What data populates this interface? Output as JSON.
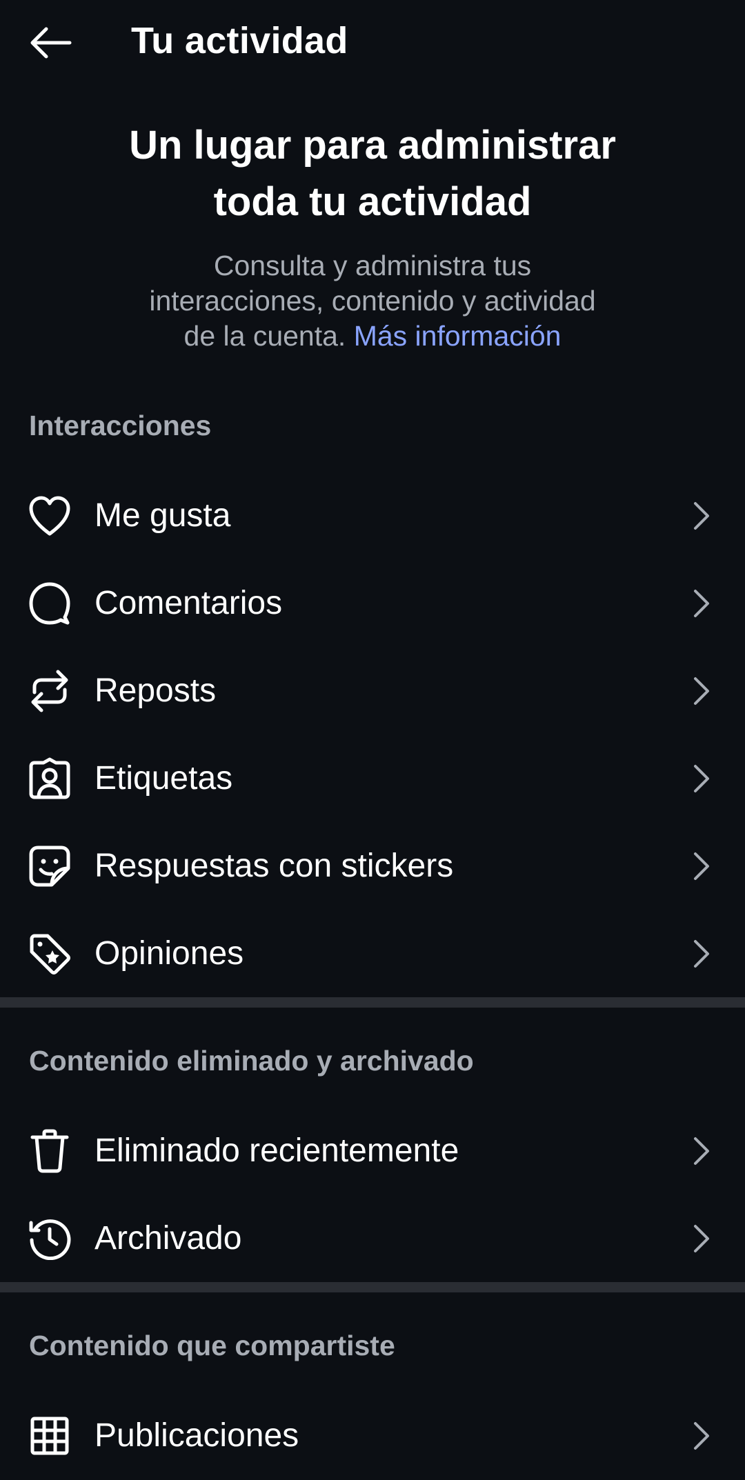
{
  "header": {
    "title": "Tu actividad"
  },
  "hero": {
    "title_line1": "Un lugar para administrar",
    "title_line2": "toda tu actividad",
    "description_line1": "Consulta y administra tus",
    "description_line2": "interacciones, contenido y actividad",
    "description_line3": "de la cuenta. ",
    "link": "Más información",
    "link_color": "#8aa4ff"
  },
  "sections": [
    {
      "header": "Interacciones",
      "items": [
        {
          "label": "Me gusta",
          "icon": "heart-icon"
        },
        {
          "label": "Comentarios",
          "icon": "comment-icon"
        },
        {
          "label": "Reposts",
          "icon": "repost-icon"
        },
        {
          "label": "Etiquetas",
          "icon": "tag-person-icon"
        },
        {
          "label": "Respuestas con stickers",
          "icon": "sticker-icon"
        },
        {
          "label": "Opiniones",
          "icon": "price-tag-star-icon"
        }
      ]
    },
    {
      "header": "Contenido eliminado y archivado",
      "items": [
        {
          "label": "Eliminado recientemente",
          "icon": "trash-icon"
        },
        {
          "label": "Archivado",
          "icon": "history-icon"
        }
      ]
    },
    {
      "header": "Contenido que compartiste",
      "items": [
        {
          "label": "Publicaciones",
          "icon": "grid-icon"
        }
      ]
    }
  ],
  "colors": {
    "background": "#0c0f14",
    "divider": "#2a2d33",
    "muted_text": "#a8adb5",
    "primary_text": "#ffffff"
  }
}
